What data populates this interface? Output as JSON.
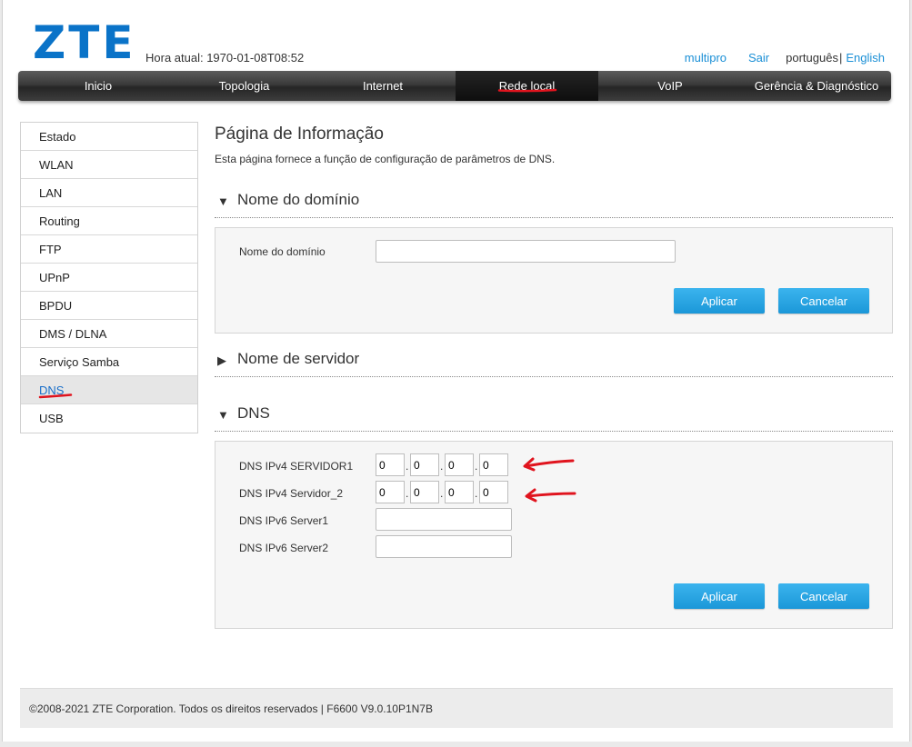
{
  "header": {
    "logo": "ZTE",
    "current_time": "Hora atual: 1970-01-08T08:52",
    "user": "multipro",
    "logout": "Sair",
    "lang_current": "português",
    "lang_separator": "|",
    "lang_other": "English"
  },
  "nav": {
    "items": [
      "Inicio",
      "Topologia",
      "Internet",
      "Rede local",
      "VoIP",
      "Gerência & Diagnóstico"
    ],
    "active": "Rede local"
  },
  "sidebar": {
    "items": [
      "Estado",
      "WLAN",
      "LAN",
      "Routing",
      "FTP",
      "UPnP",
      "BPDU",
      "DMS / DLNA",
      "Serviço Samba",
      "DNS",
      "USB"
    ],
    "active": "DNS"
  },
  "page": {
    "title": "Página de Informação",
    "description": "Esta página fornece a função de configuração de parâmetros de DNS."
  },
  "domain_section": {
    "title": "Nome do domínio",
    "expanded": true,
    "label": "Nome do domínio",
    "value": "",
    "apply": "Aplicar",
    "cancel": "Cancelar"
  },
  "server_section": {
    "title": "Nome de servidor",
    "expanded": false
  },
  "dns_section": {
    "title": "DNS",
    "expanded": true,
    "ipv4_server1_label": "DNS IPv4 SERVIDOR1",
    "ipv4_server1": [
      "0",
      "0",
      "0",
      "0"
    ],
    "ipv4_server2_label": "DNS IPv4 Servidor_2",
    "ipv4_server2": [
      "0",
      "0",
      "0",
      "0"
    ],
    "ipv6_server1_label": "DNS IPv6 Server1",
    "ipv6_server1": "",
    "ipv6_server2_label": "DNS IPv6 Server2",
    "ipv6_server2": "",
    "apply": "Aplicar",
    "cancel": "Cancelar"
  },
  "icons": {
    "expanded": "triangle-down-icon",
    "collapsed": "triangle-right-icon",
    "annotation": "red-arrow-annotation-icon"
  },
  "colors": {
    "brand": "#0a73c8",
    "link": "#1a8fd6",
    "button": "#1b97d8",
    "annotation": "#e0141e"
  },
  "footer": {
    "text": "©2008-2021 ZTE Corporation. Todos os direitos reservados  |   F6600 V9.0.10P1N7B"
  }
}
